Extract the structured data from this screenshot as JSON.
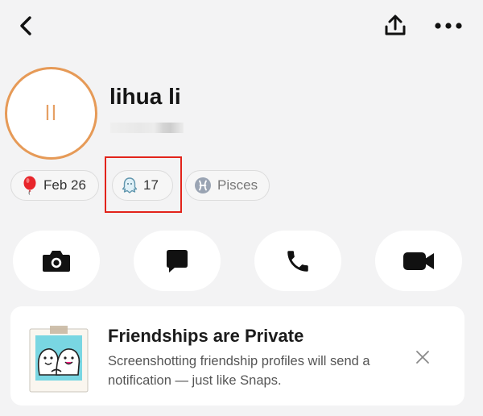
{
  "nav": {
    "back_icon": "chevron-left-icon",
    "share_icon": "share-upload-icon",
    "more_icon": "more-dots-icon"
  },
  "profile": {
    "initials": "ll",
    "display_name": "lihua li",
    "username_blurred": true
  },
  "chips": [
    {
      "icon": "balloon-icon",
      "label": "Feb 26"
    },
    {
      "icon": "ghost-icon",
      "label": "17",
      "highlighted": true
    },
    {
      "icon": "pisces-icon",
      "label": "Pisces"
    }
  ],
  "actions": [
    {
      "icon": "camera-icon"
    },
    {
      "icon": "chat-icon"
    },
    {
      "icon": "phone-icon"
    },
    {
      "icon": "video-icon"
    }
  ],
  "card": {
    "title": "Friendships are Private",
    "body": "Screenshotting friendship profiles will send a notification — just like Snaps.",
    "close_icon": "close-icon"
  },
  "colors": {
    "background": "#f3f3f4",
    "avatar_ring": "#e69a57",
    "highlight_box": "#e2231a"
  }
}
